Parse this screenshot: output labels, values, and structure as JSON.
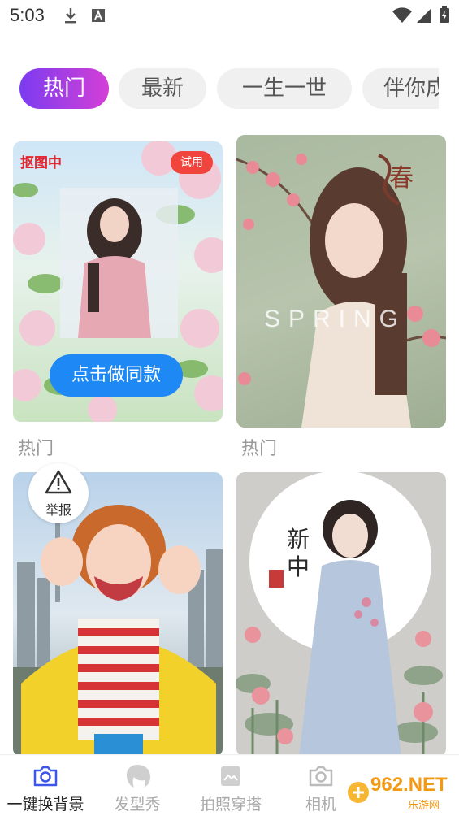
{
  "status_bar": {
    "time": "5:03"
  },
  "tabs": [
    {
      "label": "热门",
      "active": true
    },
    {
      "label": "最新",
      "active": false
    },
    {
      "label": "一生一世",
      "active": false
    },
    {
      "label": "伴你成",
      "active": false
    }
  ],
  "cards": [
    {
      "cutout_badge": "抠图中",
      "trial_badge": "试用",
      "cta": "点击做同款",
      "label": "热门"
    },
    {
      "overlay_text": "SPRING",
      "calligraphy": "春",
      "label": "热门"
    },
    {
      "report": "举报"
    },
    {
      "calligraphy": "新中"
    }
  ],
  "bottom_nav": [
    {
      "label": "一键换背景",
      "icon": "camera-icon",
      "active": true
    },
    {
      "label": "发型秀",
      "icon": "hair-icon",
      "active": false
    },
    {
      "label": "拍照穿搭",
      "icon": "photo-icon",
      "active": false
    },
    {
      "label": "相机",
      "icon": "camera-icon",
      "active": false
    }
  ],
  "watermark": {
    "main": "962.NET",
    "sub": "乐游网"
  },
  "colors": {
    "accent_start": "#7b3cf0",
    "accent_end": "#d33fd6",
    "cta": "#1e88f5",
    "badge": "#f0443c"
  }
}
